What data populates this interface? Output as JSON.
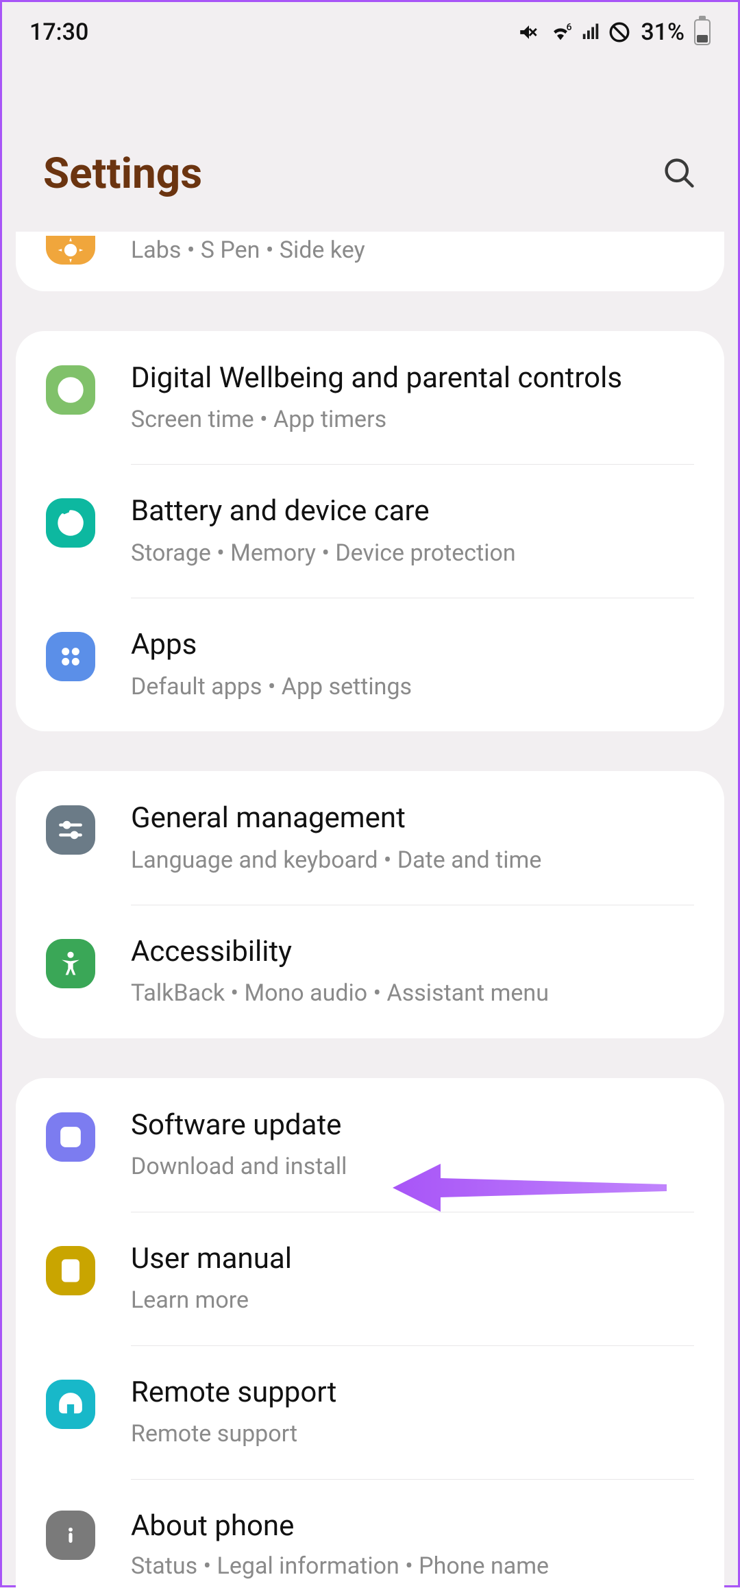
{
  "status": {
    "time": "17:30",
    "battery": "31%"
  },
  "header": {
    "title": "Settings"
  },
  "groups": [
    {
      "items": [
        {
          "id": "advanced",
          "title": "",
          "sub": "Labs  •  S Pen  •  Side key",
          "iconBg": "bg-amber",
          "icon": "gear-plus"
        }
      ],
      "partialTop": true
    },
    {
      "items": [
        {
          "id": "wellbeing",
          "title": "Digital Wellbeing and parental controls",
          "sub": "Screen time  •  App timers",
          "iconBg": "bg-green",
          "icon": "heart-target"
        },
        {
          "id": "battery",
          "title": "Battery and device care",
          "sub": "Storage  •  Memory  •  Device protection",
          "iconBg": "bg-teal",
          "icon": "care"
        },
        {
          "id": "apps",
          "title": "Apps",
          "sub": "Default apps  •  App settings",
          "iconBg": "bg-blue",
          "icon": "dots4"
        }
      ]
    },
    {
      "items": [
        {
          "id": "general",
          "title": "General management",
          "sub": "Language and keyboard  •  Date and time",
          "iconBg": "bg-slate",
          "icon": "sliders"
        },
        {
          "id": "accessibility",
          "title": "Accessibility",
          "sub": "TalkBack  •  Mono audio  •  Assistant menu",
          "iconBg": "bg-green2",
          "icon": "person"
        }
      ]
    },
    {
      "items": [
        {
          "id": "software",
          "title": "Software update",
          "sub": "Download and install",
          "iconBg": "bg-violet",
          "icon": "refresh-sq"
        },
        {
          "id": "manual",
          "title": "User manual",
          "sub": "Learn more",
          "iconBg": "bg-gold",
          "icon": "book-q"
        },
        {
          "id": "remote",
          "title": "Remote support",
          "sub": "Remote support",
          "iconBg": "bg-cyan",
          "icon": "headset"
        },
        {
          "id": "about",
          "title": "About phone",
          "sub": "Status  •  Legal information  •  Phone name",
          "iconBg": "bg-gray",
          "icon": "info"
        }
      ],
      "partialBottom": true
    }
  ]
}
